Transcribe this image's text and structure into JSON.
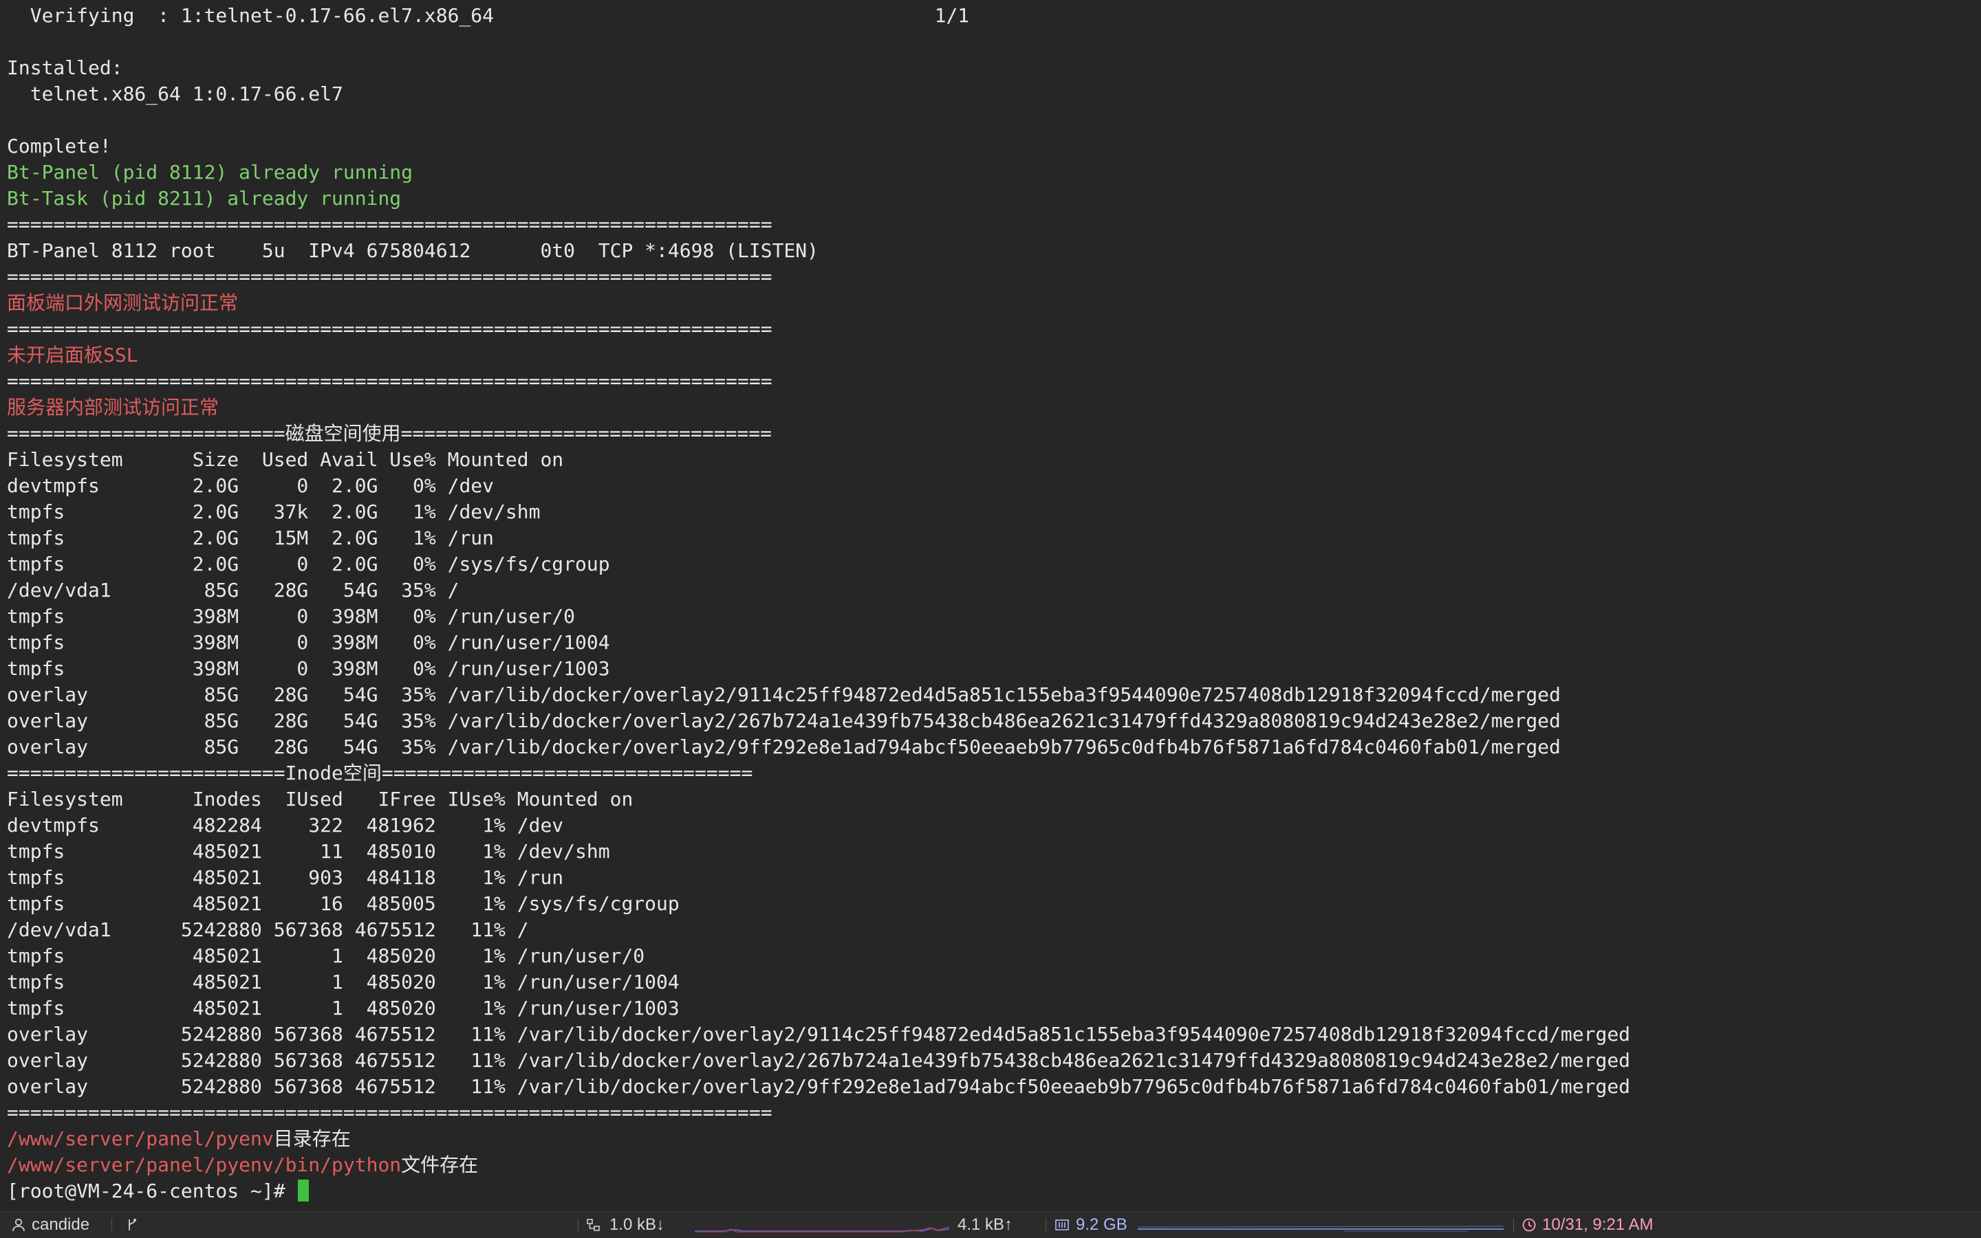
{
  "terminal": {
    "lines": [
      {
        "color": "white",
        "text": "  Verifying  : 1:telnet-0.17-66.el7.x86_64                                      1/1"
      },
      {
        "color": "white",
        "text": ""
      },
      {
        "color": "white",
        "text": "Installed:"
      },
      {
        "color": "white",
        "text": "  telnet.x86_64 1:0.17-66.el7"
      },
      {
        "color": "white",
        "text": ""
      },
      {
        "color": "white",
        "text": "Complete!"
      },
      {
        "color": "green",
        "text": "Bt-Panel (pid 8112) already running"
      },
      {
        "color": "green",
        "text": "Bt-Task (pid 8211) already running"
      },
      {
        "color": "white",
        "text": "=================================================================="
      },
      {
        "color": "white",
        "text": "BT-Panel 8112 root    5u  IPv4 675804612      0t0  TCP *:4698 (LISTEN)"
      },
      {
        "color": "white",
        "text": "=================================================================="
      },
      {
        "color": "red",
        "text": "面板端口外网测试访问正常"
      },
      {
        "color": "white",
        "text": "=================================================================="
      },
      {
        "color": "red",
        "text": "未开启面板SSL"
      },
      {
        "color": "white",
        "text": "=================================================================="
      },
      {
        "color": "red",
        "text": "服务器内部测试访问正常"
      },
      {
        "color": "white",
        "text": "========================磁盘空间使用================================"
      },
      {
        "color": "white",
        "text": "Filesystem      Size  Used Avail Use% Mounted on"
      },
      {
        "color": "white",
        "text": "devtmpfs        2.0G     0  2.0G   0% /dev"
      },
      {
        "color": "white",
        "text": "tmpfs           2.0G   37k  2.0G   1% /dev/shm"
      },
      {
        "color": "white",
        "text": "tmpfs           2.0G   15M  2.0G   1% /run"
      },
      {
        "color": "white",
        "text": "tmpfs           2.0G     0  2.0G   0% /sys/fs/cgroup"
      },
      {
        "color": "white",
        "text": "/dev/vda1        85G   28G   54G  35% /"
      },
      {
        "color": "white",
        "text": "tmpfs           398M     0  398M   0% /run/user/0"
      },
      {
        "color": "white",
        "text": "tmpfs           398M     0  398M   0% /run/user/1004"
      },
      {
        "color": "white",
        "text": "tmpfs           398M     0  398M   0% /run/user/1003"
      },
      {
        "color": "white",
        "text": "overlay          85G   28G   54G  35% /var/lib/docker/overlay2/9114c25ff94872ed4d5a851c155eba3f9544090e7257408db12918f32094fccd/merged"
      },
      {
        "color": "white",
        "text": "overlay          85G   28G   54G  35% /var/lib/docker/overlay2/267b724a1e439fb75438cb486ea2621c31479ffd4329a8080819c94d243e28e2/merged"
      },
      {
        "color": "white",
        "text": "overlay          85G   28G   54G  35% /var/lib/docker/overlay2/9ff292e8e1ad794abcf50eeaeb9b77965c0dfb4b76f5871a6fd784c0460fab01/merged"
      },
      {
        "color": "white",
        "text": "========================Inode空间================================"
      },
      {
        "color": "white",
        "text": "Filesystem      Inodes  IUsed   IFree IUse% Mounted on"
      },
      {
        "color": "white",
        "text": "devtmpfs        482284    322  481962    1% /dev"
      },
      {
        "color": "white",
        "text": "tmpfs           485021     11  485010    1% /dev/shm"
      },
      {
        "color": "white",
        "text": "tmpfs           485021    903  484118    1% /run"
      },
      {
        "color": "white",
        "text": "tmpfs           485021     16  485005    1% /sys/fs/cgroup"
      },
      {
        "color": "white",
        "text": "/dev/vda1      5242880 567368 4675512   11% /"
      },
      {
        "color": "white",
        "text": "tmpfs           485021      1  485020    1% /run/user/0"
      },
      {
        "color": "white",
        "text": "tmpfs           485021      1  485020    1% /run/user/1004"
      },
      {
        "color": "white",
        "text": "tmpfs           485021      1  485020    1% /run/user/1003"
      },
      {
        "color": "white",
        "text": "overlay        5242880 567368 4675512   11% /var/lib/docker/overlay2/9114c25ff94872ed4d5a851c155eba3f9544090e7257408db12918f32094fccd/merged"
      },
      {
        "color": "white",
        "text": "overlay        5242880 567368 4675512   11% /var/lib/docker/overlay2/267b724a1e439fb75438cb486ea2621c31479ffd4329a8080819c94d243e28e2/merged"
      },
      {
        "color": "white",
        "text": "overlay        5242880 567368 4675512   11% /var/lib/docker/overlay2/9ff292e8e1ad794abcf50eeaeb9b77965c0dfb4b76f5871a6fd784c0460fab01/merged"
      },
      {
        "color": "white",
        "text": "=================================================================="
      },
      {
        "segments": [
          {
            "color": "red",
            "text": "/www/server/panel/pyenv"
          },
          {
            "color": "white",
            "text": "目录存在"
          }
        ]
      },
      {
        "segments": [
          {
            "color": "red",
            "text": "/www/server/panel/pyenv/bin/python"
          },
          {
            "color": "white",
            "text": "文件存在"
          }
        ]
      }
    ],
    "prompt": "[root@VM-24-6-centos ~]# "
  },
  "statusbar": {
    "user": "candide",
    "net_down": "1.0 kB↓",
    "net_up": "4.1 kB↑",
    "memory": "9.2 GB",
    "datetime": "10/31, 9:21 AM"
  },
  "colors": {
    "background": "#262626",
    "text": "#e8e8e8",
    "green": "#7fcf6e",
    "red": "#e05c5c",
    "cursor": "#3fbf3f",
    "net_down_graph": "#3c62d6",
    "net_up_graph": "#c0392b",
    "memory_accent": "#a9b8ff",
    "datetime_accent": "#ff9dc0"
  },
  "icons": {
    "user": "person-icon",
    "git": "git-branch-icon",
    "network": "network-icon",
    "memory": "memory-chip-icon",
    "clock": "clock-icon"
  }
}
